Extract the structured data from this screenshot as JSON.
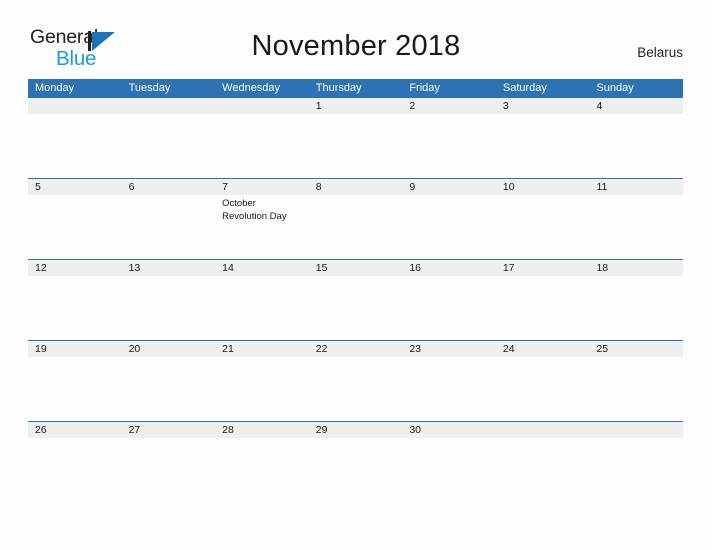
{
  "brand": {
    "line1": "General",
    "line2": "Blue",
    "mark_icon": "general-blue-triangle-logo",
    "color_dark": "#231f20",
    "color_blue": "#1b75bb",
    "color_light_blue": "#1b9ae0"
  },
  "header": {
    "title": "November 2018",
    "region": "Belarus"
  },
  "theme": {
    "header_bg": "#2d72b5",
    "band_bg": "#efefef",
    "page_bg": "#fdfdfd",
    "text": "#1a1a1a"
  },
  "calendar": {
    "weekdays": [
      "Monday",
      "Tuesday",
      "Wednesday",
      "Thursday",
      "Friday",
      "Saturday",
      "Sunday"
    ],
    "weeks": [
      {
        "days": [
          {
            "num": "",
            "event": ""
          },
          {
            "num": "",
            "event": ""
          },
          {
            "num": "",
            "event": ""
          },
          {
            "num": "1",
            "event": ""
          },
          {
            "num": "2",
            "event": ""
          },
          {
            "num": "3",
            "event": ""
          },
          {
            "num": "4",
            "event": ""
          }
        ]
      },
      {
        "days": [
          {
            "num": "5",
            "event": ""
          },
          {
            "num": "6",
            "event": ""
          },
          {
            "num": "7",
            "event": "October Revolution Day"
          },
          {
            "num": "8",
            "event": ""
          },
          {
            "num": "9",
            "event": ""
          },
          {
            "num": "10",
            "event": ""
          },
          {
            "num": "11",
            "event": ""
          }
        ]
      },
      {
        "days": [
          {
            "num": "12",
            "event": ""
          },
          {
            "num": "13",
            "event": ""
          },
          {
            "num": "14",
            "event": ""
          },
          {
            "num": "15",
            "event": ""
          },
          {
            "num": "16",
            "event": ""
          },
          {
            "num": "17",
            "event": ""
          },
          {
            "num": "18",
            "event": ""
          }
        ]
      },
      {
        "days": [
          {
            "num": "19",
            "event": ""
          },
          {
            "num": "20",
            "event": ""
          },
          {
            "num": "21",
            "event": ""
          },
          {
            "num": "22",
            "event": ""
          },
          {
            "num": "23",
            "event": ""
          },
          {
            "num": "24",
            "event": ""
          },
          {
            "num": "25",
            "event": ""
          }
        ]
      },
      {
        "days": [
          {
            "num": "26",
            "event": ""
          },
          {
            "num": "27",
            "event": ""
          },
          {
            "num": "28",
            "event": ""
          },
          {
            "num": "29",
            "event": ""
          },
          {
            "num": "30",
            "event": ""
          },
          {
            "num": "",
            "event": ""
          },
          {
            "num": "",
            "event": ""
          }
        ]
      }
    ]
  }
}
